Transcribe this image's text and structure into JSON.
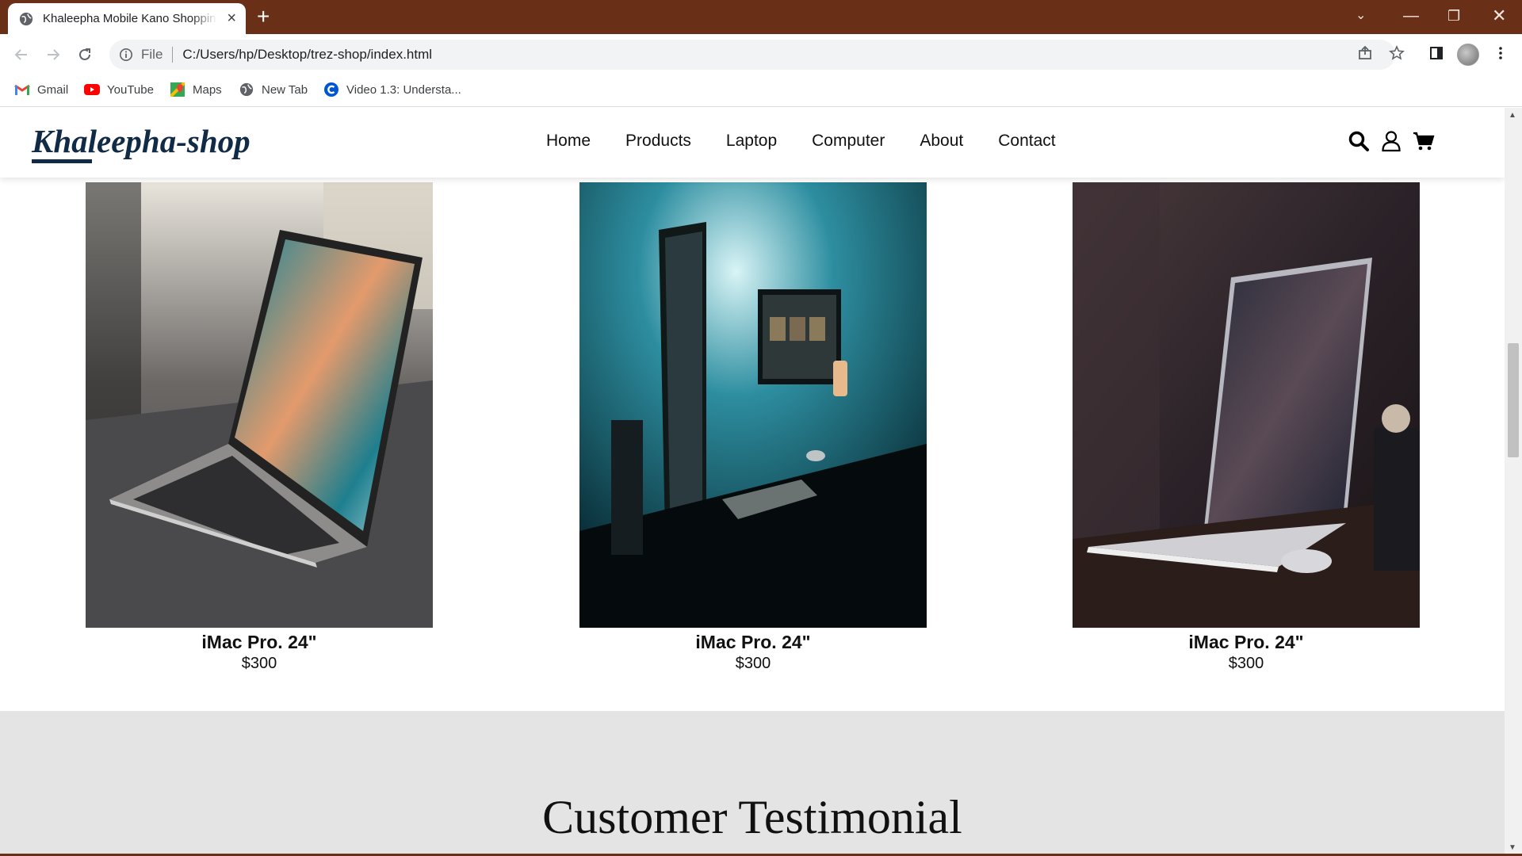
{
  "browser": {
    "tab_title": "Khaleepha Mobile Kano Shopping",
    "address_scheme": "File",
    "address_url": "C:/Users/hp/Desktop/trez-shop/index.html",
    "bookmarks": [
      {
        "label": "Gmail",
        "icon": "gmail-icon"
      },
      {
        "label": "YouTube",
        "icon": "youtube-icon"
      },
      {
        "label": "Maps",
        "icon": "maps-icon"
      },
      {
        "label": "New Tab",
        "icon": "globe-icon"
      },
      {
        "label": "Video 1.3: Understa...",
        "icon": "coursera-icon"
      }
    ]
  },
  "site": {
    "logo": "Khaleepha-shop",
    "nav": [
      "Home",
      "Products",
      "Laptop",
      "Computer",
      "About",
      "Contact"
    ],
    "icons": [
      "search-icon",
      "user-icon",
      "cart-icon"
    ]
  },
  "products": [
    {
      "name": "iMac Pro. 24\"",
      "price": "$300",
      "image": "laptop-on-desk-photo"
    },
    {
      "name": "iMac Pro. 24\"",
      "price": "$300",
      "image": "desktop-monitor-setup-photo"
    },
    {
      "name": "iMac Pro. 24\"",
      "price": "$300",
      "image": "macbook-dark-room-photo"
    }
  ],
  "testimonial": {
    "heading": "Customer Testimonial"
  },
  "colors": {
    "titlebar": "#6a2f17",
    "logo": "#112a46",
    "testimonial_bg": "#e4e4e4"
  }
}
